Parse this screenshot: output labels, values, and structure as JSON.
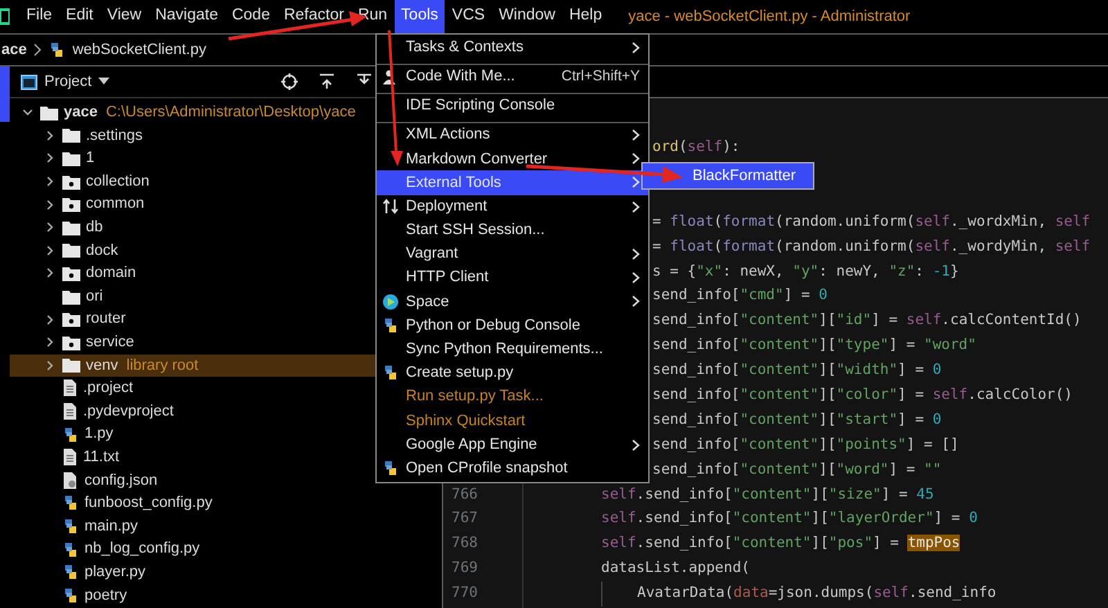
{
  "menubar": {
    "items": [
      {
        "label": "File",
        "selected": false
      },
      {
        "label": "Edit",
        "selected": false
      },
      {
        "label": "View",
        "selected": false
      },
      {
        "label": "Navigate",
        "selected": false
      },
      {
        "label": "Code",
        "selected": false
      },
      {
        "label": "Refactor",
        "selected": false
      },
      {
        "label": "Run",
        "selected": false
      },
      {
        "label": "Tools",
        "selected": true
      },
      {
        "label": "VCS",
        "selected": false
      },
      {
        "label": "Window",
        "selected": false
      },
      {
        "label": "Help",
        "selected": false
      }
    ],
    "title": "yace - webSocketClient.py - Administrator"
  },
  "breadcrumb": {
    "project": "ace",
    "file": "webSocketClient.py"
  },
  "project_panel": {
    "title": "Project",
    "tree": [
      {
        "label": "yace",
        "path": "C:\\Users\\Administrator\\Desktop\\yace",
        "kind": "folder",
        "expanded": true,
        "selected": false,
        "children": [
          {
            "label": ".settings",
            "kind": "folder",
            "expanded": false,
            "selected": false
          },
          {
            "label": "1",
            "kind": "folder",
            "expanded": false,
            "selected": false
          },
          {
            "label": "collection",
            "kind": "package",
            "expanded": false,
            "selected": false
          },
          {
            "label": "common",
            "kind": "package",
            "expanded": false,
            "selected": false
          },
          {
            "label": "db",
            "kind": "folder",
            "expanded": false,
            "selected": false
          },
          {
            "label": "dock",
            "kind": "folder",
            "expanded": false,
            "selected": false
          },
          {
            "label": "domain",
            "kind": "package",
            "expanded": false,
            "selected": false
          },
          {
            "label": "ori",
            "kind": "folder",
            "selected": false
          },
          {
            "label": "router",
            "kind": "package",
            "expanded": false,
            "selected": false
          },
          {
            "label": "service",
            "kind": "package",
            "expanded": false,
            "selected": false
          },
          {
            "label": "venv",
            "note": "library root",
            "kind": "folder",
            "expanded": false,
            "selected": true
          },
          {
            "label": ".project",
            "kind": "text",
            "selected": false
          },
          {
            "label": ".pydevproject",
            "kind": "text",
            "selected": false
          },
          {
            "label": "1.py",
            "kind": "python",
            "selected": false
          },
          {
            "label": "11.txt",
            "kind": "text",
            "selected": false
          },
          {
            "label": "config.json",
            "kind": "json",
            "selected": false
          },
          {
            "label": "funboost_config.py",
            "kind": "python",
            "selected": false
          },
          {
            "label": "main.py",
            "kind": "python",
            "selected": false
          },
          {
            "label": "nb_log_config.py",
            "kind": "python",
            "selected": false
          },
          {
            "label": "player.py",
            "kind": "python",
            "selected": false
          },
          {
            "label": "poetry",
            "kind": "python",
            "selected": false
          }
        ]
      }
    ]
  },
  "editor": {
    "lines": [
      {
        "kind": "partial",
        "tokens": [
          {
            "kind": "func",
            "text": "ord"
          },
          {
            "kind": "plain",
            "text": "("
          },
          {
            "kind": "self",
            "text": "self"
          },
          {
            "kind": "plain",
            "text": "):"
          }
        ]
      },
      {
        "kind": "blank"
      },
      {
        "kind": "blank"
      },
      {
        "kind": "partial",
        "tokens": [
          {
            "kind": "plain",
            "text": "= "
          },
          {
            "kind": "builtin",
            "text": "float"
          },
          {
            "kind": "plain",
            "text": "("
          },
          {
            "kind": "builtin",
            "text": "format"
          },
          {
            "kind": "plain",
            "text": "(random.uniform("
          },
          {
            "kind": "self",
            "text": "self"
          },
          {
            "kind": "plain",
            "text": "._wordxMin, "
          },
          {
            "kind": "self",
            "text": "self"
          }
        ]
      },
      {
        "kind": "partial",
        "tokens": [
          {
            "kind": "plain",
            "text": "= "
          },
          {
            "kind": "builtin",
            "text": "float"
          },
          {
            "kind": "plain",
            "text": "("
          },
          {
            "kind": "builtin",
            "text": "format"
          },
          {
            "kind": "plain",
            "text": "(random.uniform("
          },
          {
            "kind": "self",
            "text": "self"
          },
          {
            "kind": "plain",
            "text": "._wordyMin, "
          },
          {
            "kind": "self",
            "text": "self"
          }
        ]
      },
      {
        "kind": "partial",
        "tokens": [
          {
            "kind": "plain",
            "text": "s = {"
          },
          {
            "kind": "string",
            "text": "\"x\""
          },
          {
            "kind": "plain",
            "text": ": newX, "
          },
          {
            "kind": "string",
            "text": "\"y\""
          },
          {
            "kind": "plain",
            "text": ": newY, "
          },
          {
            "kind": "string",
            "text": "\"z\""
          },
          {
            "kind": "plain",
            "text": ": "
          },
          {
            "kind": "number",
            "text": "-1"
          },
          {
            "kind": "plain",
            "text": "}"
          }
        ]
      },
      {
        "kind": "partial",
        "tokens": [
          {
            "kind": "plain",
            "text": "send_info["
          },
          {
            "kind": "string",
            "text": "\"cmd\""
          },
          {
            "kind": "plain",
            "text": "] = "
          },
          {
            "kind": "number",
            "text": "0"
          }
        ]
      },
      {
        "kind": "partial",
        "tokens": [
          {
            "kind": "plain",
            "text": "send_info["
          },
          {
            "kind": "string",
            "text": "\"content\""
          },
          {
            "kind": "plain",
            "text": "]["
          },
          {
            "kind": "string",
            "text": "\"id\""
          },
          {
            "kind": "plain",
            "text": "] = "
          },
          {
            "kind": "self",
            "text": "self"
          },
          {
            "kind": "plain",
            "text": ".calcContentId()"
          }
        ]
      },
      {
        "kind": "partial",
        "tokens": [
          {
            "kind": "plain",
            "text": "send_info["
          },
          {
            "kind": "string",
            "text": "\"content\""
          },
          {
            "kind": "plain",
            "text": "]["
          },
          {
            "kind": "string",
            "text": "\"type\""
          },
          {
            "kind": "plain",
            "text": "] = "
          },
          {
            "kind": "string",
            "text": "\"word\""
          }
        ]
      },
      {
        "kind": "partial",
        "tokens": [
          {
            "kind": "plain",
            "text": "send_info["
          },
          {
            "kind": "string",
            "text": "\"content\""
          },
          {
            "kind": "plain",
            "text": "]["
          },
          {
            "kind": "string",
            "text": "\"width\""
          },
          {
            "kind": "plain",
            "text": "] = "
          },
          {
            "kind": "number",
            "text": "0"
          }
        ]
      },
      {
        "kind": "partial",
        "tokens": [
          {
            "kind": "plain",
            "text": "send_info["
          },
          {
            "kind": "string",
            "text": "\"content\""
          },
          {
            "kind": "plain",
            "text": "]["
          },
          {
            "kind": "string",
            "text": "\"color\""
          },
          {
            "kind": "plain",
            "text": "] = "
          },
          {
            "kind": "self",
            "text": "self"
          },
          {
            "kind": "plain",
            "text": ".calcColor()"
          }
        ]
      },
      {
        "kind": "partial",
        "tokens": [
          {
            "kind": "plain",
            "text": "send_info["
          },
          {
            "kind": "string",
            "text": "\"content\""
          },
          {
            "kind": "plain",
            "text": "]["
          },
          {
            "kind": "string",
            "text": "\"start\""
          },
          {
            "kind": "plain",
            "text": "] = "
          },
          {
            "kind": "number",
            "text": "0"
          }
        ]
      },
      {
        "kind": "partial",
        "tokens": [
          {
            "kind": "plain",
            "text": "send_info["
          },
          {
            "kind": "string",
            "text": "\"content\""
          },
          {
            "kind": "plain",
            "text": "]["
          },
          {
            "kind": "string",
            "text": "\"points\""
          },
          {
            "kind": "plain",
            "text": "] = []"
          }
        ]
      },
      {
        "kind": "partial",
        "tokens": [
          {
            "kind": "plain",
            "text": "send_info["
          },
          {
            "kind": "string",
            "text": "\"content\""
          },
          {
            "kind": "plain",
            "text": "]["
          },
          {
            "kind": "string",
            "text": "\"word\""
          },
          {
            "kind": "plain",
            "text": "] = "
          },
          {
            "kind": "string",
            "text": "\"\""
          }
        ]
      },
      {
        "kind": "body",
        "number": "766",
        "tokens": [
          {
            "kind": "self",
            "text": "self"
          },
          {
            "kind": "plain",
            "text": ".send_info["
          },
          {
            "kind": "string",
            "text": "\"content\""
          },
          {
            "kind": "plain",
            "text": "]["
          },
          {
            "kind": "string",
            "text": "\"size\""
          },
          {
            "kind": "plain",
            "text": "] = "
          },
          {
            "kind": "number",
            "text": "45"
          }
        ]
      },
      {
        "kind": "body",
        "number": "767",
        "tokens": [
          {
            "kind": "self",
            "text": "self"
          },
          {
            "kind": "plain",
            "text": ".send_info["
          },
          {
            "kind": "string",
            "text": "\"content\""
          },
          {
            "kind": "plain",
            "text": "]["
          },
          {
            "kind": "string",
            "text": "\"layerOrder\""
          },
          {
            "kind": "plain",
            "text": "] = "
          },
          {
            "kind": "number",
            "text": "0"
          }
        ]
      },
      {
        "kind": "body",
        "number": "768",
        "tokens": [
          {
            "kind": "self",
            "text": "self"
          },
          {
            "kind": "plain",
            "text": ".send_info["
          },
          {
            "kind": "string",
            "text": "\"content\""
          },
          {
            "kind": "plain",
            "text": "]["
          },
          {
            "kind": "string",
            "text": "\"pos\""
          },
          {
            "kind": "plain",
            "text": "] = "
          },
          {
            "kind": "highlight",
            "text": "tmpPos"
          }
        ]
      },
      {
        "kind": "body",
        "number": "769",
        "tokens": [
          {
            "kind": "plain",
            "text": "datasList.append("
          }
        ]
      },
      {
        "kind": "nested",
        "number": "770",
        "tokens": [
          {
            "kind": "plain",
            "text": "AvatarData("
          },
          {
            "kind": "param",
            "text": "data"
          },
          {
            "kind": "plain",
            "text": "=json.dumps("
          },
          {
            "kind": "self",
            "text": "self"
          },
          {
            "kind": "plain",
            "text": ".send_info"
          }
        ]
      }
    ]
  },
  "tools_menu": {
    "items": [
      {
        "label": "Tasks & Contexts",
        "kind": "plain",
        "submenu": true,
        "separator_after": true,
        "selected": false,
        "disabled": false
      },
      {
        "label": "Code With Me...",
        "kind": "person",
        "shortcut": "Ctrl+Shift+Y",
        "submenu": false,
        "separator_after": true,
        "selected": false,
        "disabled": false
      },
      {
        "label": "IDE Scripting Console",
        "kind": "plain",
        "submenu": false,
        "separator_after": true,
        "selected": false,
        "disabled": false
      },
      {
        "label": "XML Actions",
        "kind": "plain",
        "submenu": true,
        "separator_after": false,
        "selected": false,
        "disabled": false
      },
      {
        "label": "Markdown Converter",
        "kind": "plain",
        "submenu": true,
        "separator_after": false,
        "selected": false,
        "disabled": false
      },
      {
        "label": "External Tools",
        "kind": "plain",
        "submenu": true,
        "separator_after": false,
        "selected": true,
        "disabled": false
      },
      {
        "label": "Deployment",
        "kind": "deploy",
        "submenu": true,
        "separator_after": false,
        "selected": false,
        "disabled": false
      },
      {
        "label": "Start SSH Session...",
        "kind": "plain",
        "submenu": false,
        "separator_after": false,
        "selected": false,
        "disabled": false
      },
      {
        "label": "Vagrant",
        "kind": "plain",
        "submenu": true,
        "separator_after": false,
        "selected": false,
        "disabled": false
      },
      {
        "label": "HTTP Client",
        "kind": "plain",
        "submenu": true,
        "separator_after": false,
        "selected": false,
        "disabled": false
      },
      {
        "label": "Space",
        "kind": "space",
        "submenu": true,
        "separator_after": false,
        "selected": false,
        "disabled": false
      },
      {
        "label": "Python or Debug Console",
        "kind": "python",
        "submenu": false,
        "separator_after": false,
        "selected": false,
        "disabled": false
      },
      {
        "label": "Sync Python Requirements...",
        "kind": "plain",
        "submenu": false,
        "separator_after": false,
        "selected": false,
        "disabled": false
      },
      {
        "label": "Create setup.py",
        "kind": "pyfile",
        "submenu": false,
        "separator_after": false,
        "selected": false,
        "disabled": false
      },
      {
        "label": "Run setup.py Task...",
        "kind": "plain",
        "submenu": false,
        "separator_after": false,
        "selected": false,
        "disabled": true
      },
      {
        "label": "Sphinx Quickstart",
        "kind": "plain",
        "submenu": false,
        "separator_after": false,
        "selected": false,
        "disabled": true
      },
      {
        "label": "Google App Engine",
        "kind": "plain",
        "submenu": true,
        "separator_after": false,
        "selected": false,
        "disabled": false
      },
      {
        "label": "Open CProfile snapshot",
        "kind": "python",
        "submenu": false,
        "separator_after": false,
        "selected": false,
        "disabled": false
      }
    ]
  },
  "submenu": {
    "items": [
      {
        "label": "BlackFormatter",
        "selected": true
      }
    ]
  }
}
